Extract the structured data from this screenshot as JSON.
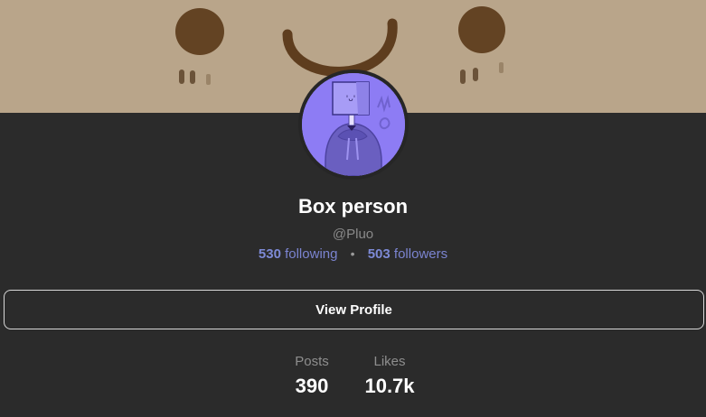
{
  "profile": {
    "display_name": "Box person",
    "handle": "@Pluo",
    "following_count": "530",
    "following_label": "following",
    "separator": "•",
    "followers_count": "503",
    "followers_label": "followers"
  },
  "actions": {
    "view_profile_label": "View Profile"
  },
  "stats": [
    {
      "label": "Posts",
      "value": "390"
    },
    {
      "label": "Likes",
      "value": "10.7k"
    }
  ],
  "avatar": {
    "face_text": "'ᴗ'"
  },
  "colors": {
    "background": "#2b2b2b",
    "banner": "#b9a58a",
    "banner_marks": "#5e3d1e",
    "avatar_bg": "#8d7cf4",
    "link_accent": "#7d8ad6",
    "text_primary": "#ffffff",
    "text_muted": "#8e8e8e"
  }
}
